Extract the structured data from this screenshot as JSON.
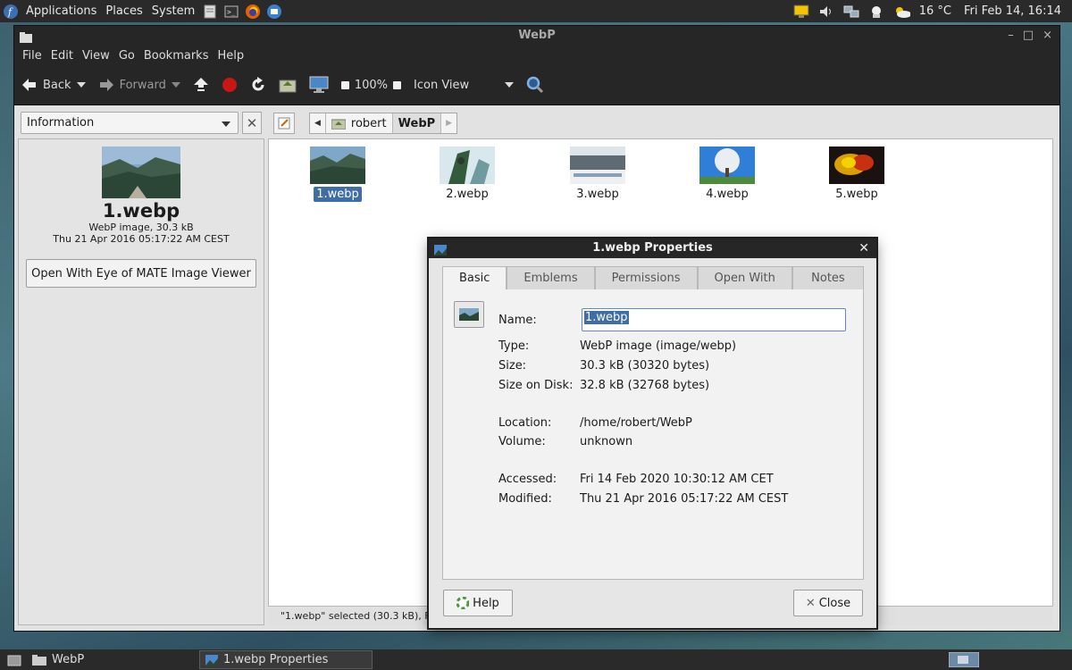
{
  "top_panel": {
    "menus": [
      "Applications",
      "Places",
      "System"
    ],
    "weather": "16 °C",
    "clock": "Fri Feb 14, 16:14"
  },
  "window": {
    "title": "WebP",
    "menu": [
      "File",
      "Edit",
      "View",
      "Go",
      "Bookmarks",
      "Help"
    ],
    "toolbar": {
      "back": "Back",
      "forward": "Forward",
      "zoom": "100%",
      "view_mode": "Icon View"
    },
    "sidebar_select": "Information",
    "breadcrumbs": [
      "robert",
      "WebP"
    ],
    "sidebar": {
      "name": "1.webp",
      "meta1": "WebP image, 30.3 kB",
      "meta2": "Thu 21 Apr 2016 05:17:22 AM CEST",
      "open_with": "Open With Eye of MATE Image Viewer"
    },
    "files": [
      "1.webp",
      "2.webp",
      "3.webp",
      "4.webp",
      "5.webp"
    ],
    "status": "\"1.webp\" selected (30.3 kB), Fr"
  },
  "dialog": {
    "title": "1.webp Properties",
    "tabs": [
      "Basic",
      "Emblems",
      "Permissions",
      "Open With",
      "Notes"
    ],
    "name_label": "Name:",
    "name_value": "1.webp",
    "props": [
      {
        "label": "Type:",
        "value": "WebP image (image/webp)"
      },
      {
        "label": "Size:",
        "value": "30.3 kB (30320 bytes)"
      },
      {
        "label": "Size on Disk:",
        "value": "32.8 kB (32768 bytes)"
      },
      {
        "label": "Location:",
        "value": "/home/robert/WebP"
      },
      {
        "label": "Volume:",
        "value": "unknown"
      },
      {
        "label": "Accessed:",
        "value": "Fri 14 Feb 2020 10:30:12 AM CET"
      },
      {
        "label": "Modified:",
        "value": "Thu 21 Apr 2016 05:17:22 AM CEST"
      }
    ],
    "help": "Help",
    "close": "Close"
  },
  "taskbar": {
    "tasks": [
      "WebP",
      "1.webp Properties"
    ]
  },
  "colors": {
    "selection": "#3e6ea5",
    "panel": "#2a2a2a",
    "titlebar": "#262626"
  }
}
